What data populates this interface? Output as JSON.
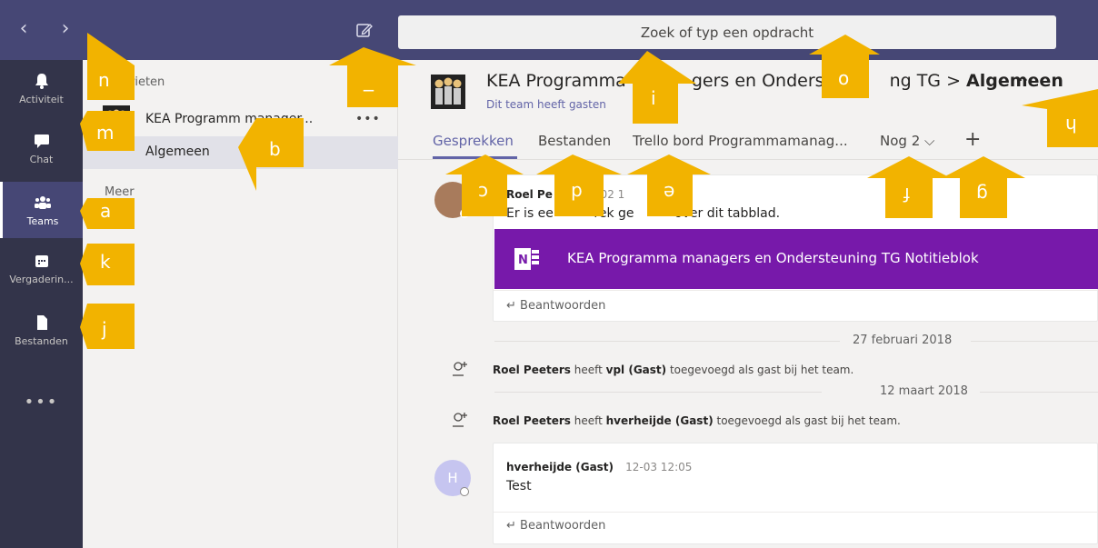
{
  "topbar": {
    "back_icon": "chevron-left-icon",
    "forward_icon": "chevron-right-icon",
    "compose_icon": "compose-icon",
    "search_placeholder": "Zoek of typ een opdracht",
    "bg_color": "#464775"
  },
  "rail": {
    "items": [
      {
        "label": "Activiteit",
        "icon": "bell-icon"
      },
      {
        "label": "Chat",
        "icon": "chat-icon"
      },
      {
        "label": "Teams",
        "icon": "teams-icon"
      },
      {
        "label": "Vergaderin...",
        "icon": "calendar-icon"
      },
      {
        "label": "Bestanden",
        "icon": "file-icon"
      }
    ],
    "more": "•••"
  },
  "teampane": {
    "favorites_label": "rieten",
    "team_name": "KEA Programm    manager...",
    "team_dots": "•••",
    "channel_name": "Algemeen",
    "more_label": "Meer"
  },
  "main": {
    "title_prefix": "KEA Programma",
    "title_mid": "gers en Onders",
    "title_end": "ng TG >",
    "channel": "Algemeen",
    "header_dots": "···",
    "subtitle": "Dit team heeft gasten",
    "tabs": [
      {
        "label": "Gesprekken"
      },
      {
        "label": "Bestanden"
      },
      {
        "label": "Trello bord Programmamanag..."
      },
      {
        "label": "Nog 2 ⌵"
      }
    ],
    "tab_plus": "+",
    "messages": {
      "first_author": "Roel Pe",
      "first_time": "21-02 1",
      "first_text": "Er is ee          rek ge          over dit tabblad.",
      "onenote_label": "KEA Programma managers en Ondersteuning TG Notitieblok",
      "reply_label": "Beantwoorden",
      "date1": "27 februari 2018",
      "event1_author": "Roel Peeters",
      "event1_mid": " heeft ",
      "event1_guest": "vpl (Gast)",
      "event1_end": " toegevoegd als gast bij het team.",
      "date2": "12 maart 2018",
      "event2_author": "Roel Peeters",
      "event2_mid": " heeft ",
      "event2_guest": "hverheijde (Gast)",
      "event2_end": " toegevoegd als gast bij het team.",
      "second_avatar": "H",
      "second_author": "hverheijde (Gast)",
      "second_time": "12-03 12:05",
      "second_text": "Test",
      "reply_label2": "Beantwoorden"
    }
  },
  "annotations": {
    "n": "n",
    "m": "m",
    "a": "a",
    "k": "k",
    "j": "j",
    "b": "b",
    "l": "_",
    "i": "i",
    "o": "o",
    "h": "h",
    "c": "c",
    "d": "d",
    "e": "e",
    "f": "f",
    "g": "g",
    "color": "#f2b300"
  }
}
